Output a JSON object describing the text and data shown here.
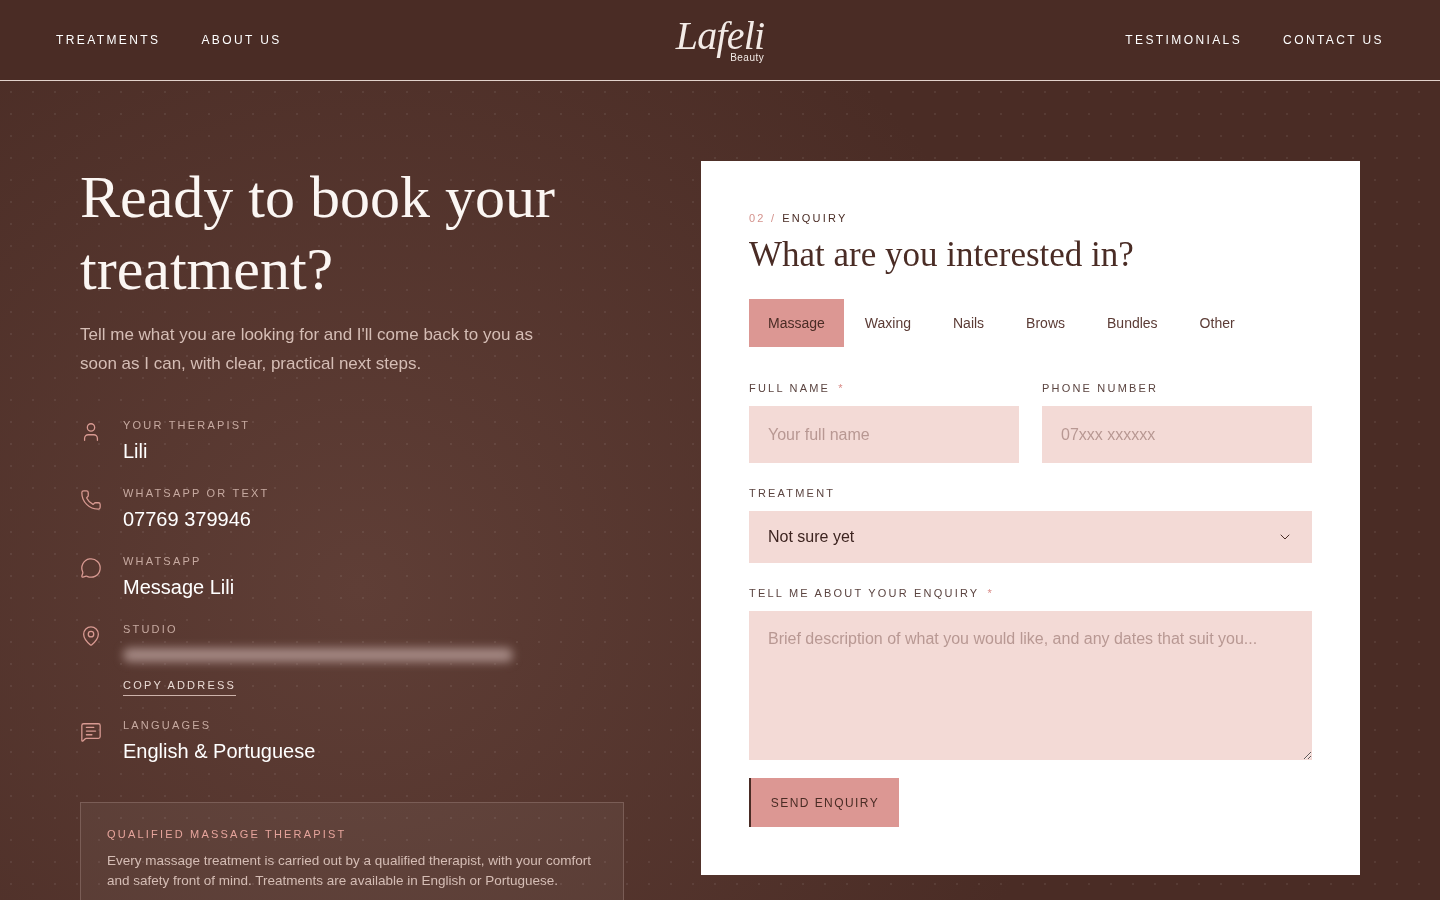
{
  "header": {
    "nav_left": [
      "TREATMENTS",
      "ABOUT US"
    ],
    "logo": {
      "script": "Lafeli",
      "subtitle": "Beauty"
    },
    "nav_right": [
      "TESTIMONIALS",
      "CONTACT US"
    ]
  },
  "intro": {
    "title": "Ready to book your treatment?",
    "text": "Tell me what you are looking for and I'll come back to you as soon as I can, with clear, practical next steps."
  },
  "contacts": [
    {
      "kind": "person",
      "label": "YOUR THERAPIST",
      "value": "Lili",
      "redacted": false
    },
    {
      "kind": "phone",
      "label": "WHATSAPP OR TEXT",
      "value": "07769 379946",
      "redacted": false
    },
    {
      "kind": "chat",
      "label": "WHATSAPP",
      "value": "Message Lili",
      "redacted": false
    },
    {
      "kind": "location",
      "label": "STUDIO",
      "redacted": true,
      "action": "COPY ADDRESS"
    },
    {
      "kind": "languages",
      "label": "LANGUAGES",
      "value": "English & Portuguese",
      "redacted": false
    }
  ],
  "note": {
    "title": "QUALIFIED MASSAGE THERAPIST",
    "text": "Every massage treatment is carried out by a qualified therapist, with your comfort and safety front of mind. Treatments are available in English or Portuguese."
  },
  "form": {
    "step": "02 /",
    "section": "ENQUIRY",
    "title": "What are you interested in?",
    "tabs": [
      {
        "label": "Massage",
        "selected": true
      },
      {
        "label": "Waxing",
        "selected": false
      },
      {
        "label": "Nails",
        "selected": false
      },
      {
        "label": "Brows",
        "selected": false
      },
      {
        "label": "Bundles",
        "selected": false
      },
      {
        "label": "Other",
        "selected": false
      }
    ],
    "fields": [
      {
        "kind": "text",
        "label": "FULL NAME",
        "mark": "*",
        "placeholder": "Your full name"
      },
      {
        "kind": "text",
        "label": "PHONE NUMBER",
        "placeholder": "07xxx xxxxxx"
      },
      {
        "kind": "select",
        "label": "TREATMENT",
        "value": "Not sure yet"
      },
      {
        "kind": "textarea",
        "label": "TELL ME ABOUT YOUR ENQUIRY",
        "mark": "*",
        "placeholder": "Brief description of what you would like, and any dates that suit you..."
      }
    ],
    "submit": "SEND ENQUIRY"
  }
}
